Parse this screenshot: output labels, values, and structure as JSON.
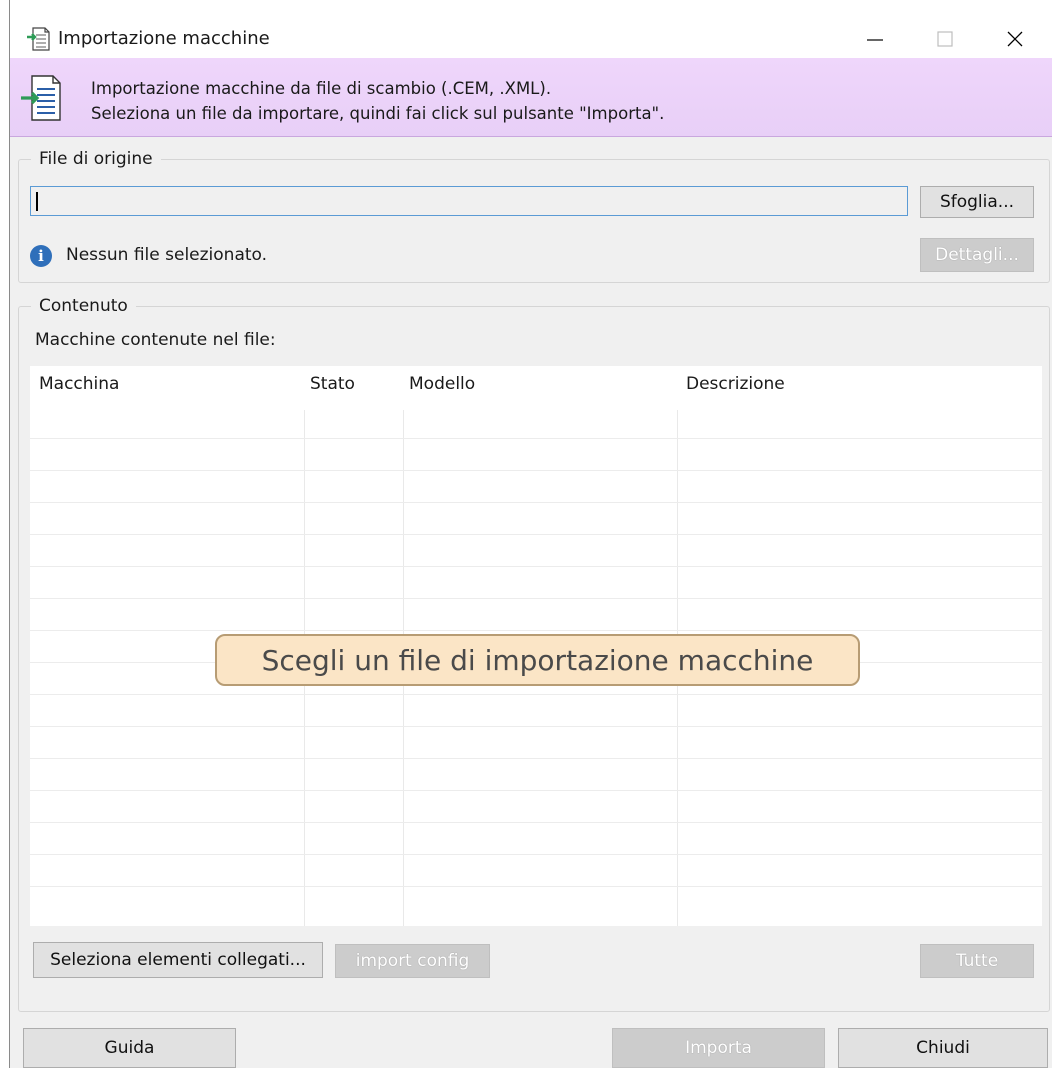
{
  "window": {
    "title": "Importazione macchine"
  },
  "banner": {
    "line1": "Importazione macchine da file di scambio (.CEM, .XML).",
    "line2": "Seleziona un file da importare, quindi fai click sul pulsante \"Importa\"."
  },
  "source": {
    "legend": "File di origine",
    "path_value": "",
    "browse_label": "Sfoglia...",
    "status_text": "Nessun file selezionato.",
    "details_label": "Dettagli..."
  },
  "content": {
    "legend": "Contenuto",
    "list_label": "Macchine contenute nel file:",
    "columns": [
      "Macchina",
      "Stato",
      "Modello",
      "Descrizione"
    ],
    "empty_hint": "Scegli un file di importazione macchine",
    "select_linked_label": "Seleziona elementi collegati...",
    "import_config_label": "import config",
    "all_label": "Tutte"
  },
  "footer": {
    "help_label": "Guida",
    "import_label": "Importa",
    "close_label": "Chiudi"
  },
  "colors": {
    "banner": "#efd6fb",
    "accent_border": "#5b9bd5",
    "hint_bg": "#fbe5c6"
  }
}
